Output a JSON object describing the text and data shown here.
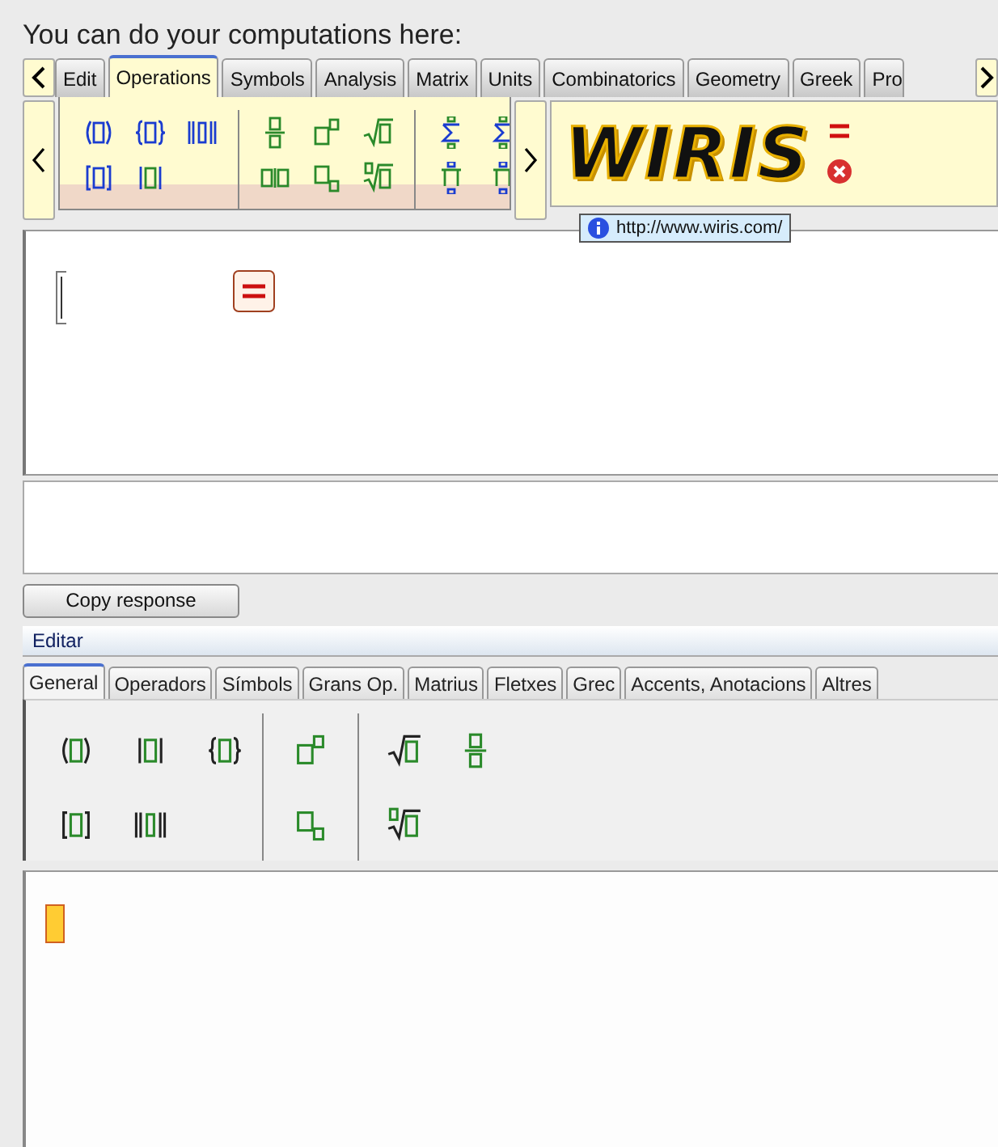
{
  "heading": "You can do your computations here:",
  "top_tabs": [
    {
      "label": "Edit",
      "selected": false
    },
    {
      "label": "Operations",
      "selected": true
    },
    {
      "label": "Symbols",
      "selected": false
    },
    {
      "label": "Analysis",
      "selected": false
    },
    {
      "label": "Matrix",
      "selected": false
    },
    {
      "label": "Units",
      "selected": false
    },
    {
      "label": "Combinatorics",
      "selected": false
    },
    {
      "label": "Geometry",
      "selected": false
    },
    {
      "label": "Greek",
      "selected": false
    },
    {
      "label": "Pro",
      "selected": false
    }
  ],
  "logo": {
    "text": "WIRIS"
  },
  "tooltip": {
    "text": "http://www.wiris.com/"
  },
  "copy_button": "Copy response",
  "editor": {
    "title": "Editar",
    "tabs": [
      {
        "label": "General",
        "selected": true
      },
      {
        "label": "Operadors",
        "selected": false
      },
      {
        "label": "Símbols",
        "selected": false
      },
      {
        "label": "Grans Op.",
        "selected": false
      },
      {
        "label": "Matrius",
        "selected": false
      },
      {
        "label": "Fletxes",
        "selected": false
      },
      {
        "label": "Grec",
        "selected": false
      },
      {
        "label": "Accents, Anotacions",
        "selected": false
      },
      {
        "label": "Altres",
        "selected": false
      }
    ]
  }
}
